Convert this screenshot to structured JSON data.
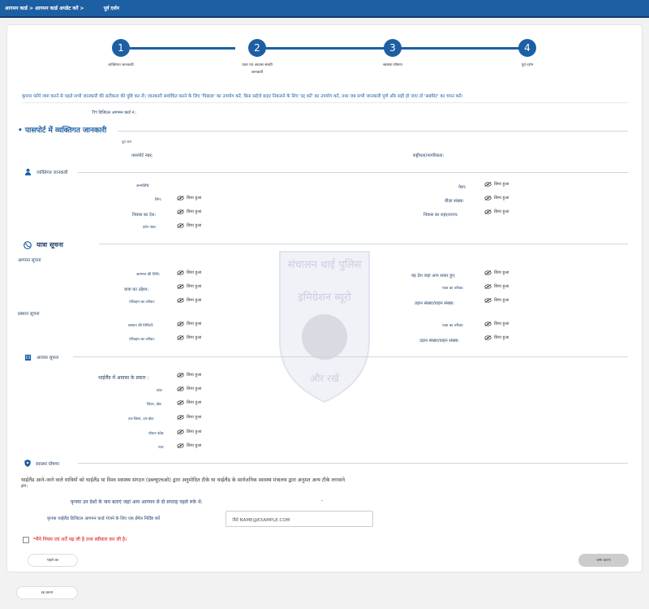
{
  "topbar": {
    "breadcrumb": "आगमन कार्ड > आगमन कार्ड अपडेट करें >",
    "current": "पूर्व दर्शन"
  },
  "steps": [
    {
      "number": "1",
      "label": "व्यक्तिगत जानकारी"
    },
    {
      "number": "2",
      "label_line1": "यात्रा एवं आवास संबंधी",
      "label_line2": "जानकारी"
    },
    {
      "number": "3",
      "label": "स्वास्थ्य घोषणा"
    },
    {
      "number": "4",
      "label": "पूर्व दर्शन"
    }
  ],
  "instruction": "कृपया फॉर्म जमा करने से पहले सभी जानकारी की सटीकता की पुष्टि कर लें। जानकारी संशोधित करने के लिए 'पिछला' का उपयोग करें, बिना सहेजे बाहर निकलने के लिए 'रद्द करें' का उपयोग करें, तथा जब सभी जानकारी पूर्ण और सही हो जाए तो 'सबमिट' का चयन करें।",
  "tdac_label": "TH डिजिटल आगमन कार्ड नं.:",
  "passport_section": {
    "title": "• पासपोर्ट में व्यक्तिगत जानकारी",
    "full_name": "पूरा नाम",
    "passport_no": "पासपोर्ट नंबर:",
    "nationality": "राष्ट्रीयता/नागरिकता:"
  },
  "hidden": "छिपा हुआ",
  "personal": {
    "title": "व्यक्तिगत जानकारी",
    "dob": "जन्मतिथि:",
    "occupation": "पेशा:",
    "gender": "लिंग:",
    "visa": "वीज़ा संख्या:",
    "country": "निवास का देश:",
    "city": "निवास का शहर/राज्य:",
    "phone": "फ़ोन नंबर:"
  },
  "travel": {
    "title": "यात्रा सूचना",
    "arrival_title": "आगमन सूचना",
    "arrival_date": "आगमन की तिथि:",
    "boarded_country": "वह देश जहां आप सवार हुए:",
    "purpose": "यात्रा का उद्देश्य:",
    "travel_mode": "यात्रा का तरीका:",
    "transport_mode": "परिवहन का तरीका:",
    "flight_no": "उड़ान संख्या/वाहन संख्या:",
    "departure_title": "प्रस्थान सूचना",
    "departure_date": "प्रस्थान की तिथियाँ:",
    "dep_travel_mode": "यात्रा का तरीका:",
    "dep_transport_mode": "परिवहन का तरीका:",
    "dep_flight_no": "उड़ान संख्या/वाहन संख्या:"
  },
  "accommodation": {
    "title": "आवास सूचना",
    "type": "थाईलैंड में आवास के प्रकार :",
    "province": "प्रांत:",
    "district": "जिला, क्षेत्र:",
    "subdistrict": "उप-जिला, उप-क्षेत्र:",
    "postcode": "पोस्टर कोड:",
    "address": "पता:"
  },
  "health": {
    "title": "स्वास्थ्य घोषणा",
    "statement": "थाईलैंड आने-जाने वाले यात्रियों को थाईलैंड या विश्व स्वास्थ्य संगठन (डब्ल्यूएचओ) द्वारा अनुमोदित टीके या थाईलैंड के सार्वजनिक स्वास्थ्य मंत्रालय द्वारा अनुमत अन्य टीके लगवाने",
    "note": "होंगे।",
    "countries_label": "कृपया उन देशों के नाम बताएं जहां आप आगमन से दो सप्ताह पहले रुके थे:",
    "countries_value": "-",
    "email_label": "कृपया थाईलैंड डिजिटल आगमन कार्ड भेजने के लिए एक ईमेल निर्दिष्ट करें",
    "email_placeholder": "जैसे NAME@EXAMPLE.COM"
  },
  "terms": "*मैंने नियम एवं शर्तें पढ़ ली है तथा स्वीकार कर ली है।",
  "buttons": {
    "back": "पहले का",
    "submit": "जमा करना",
    "cancel": "रद्द करना"
  },
  "watermark": {
    "line1": "संचालन थाई पुलिस",
    "line2": "इमिग्रेशन ब्यूरो",
    "line3": "और रखें"
  },
  "colors": {
    "primary": "#1c5fa3",
    "terms": "#dd1111"
  }
}
